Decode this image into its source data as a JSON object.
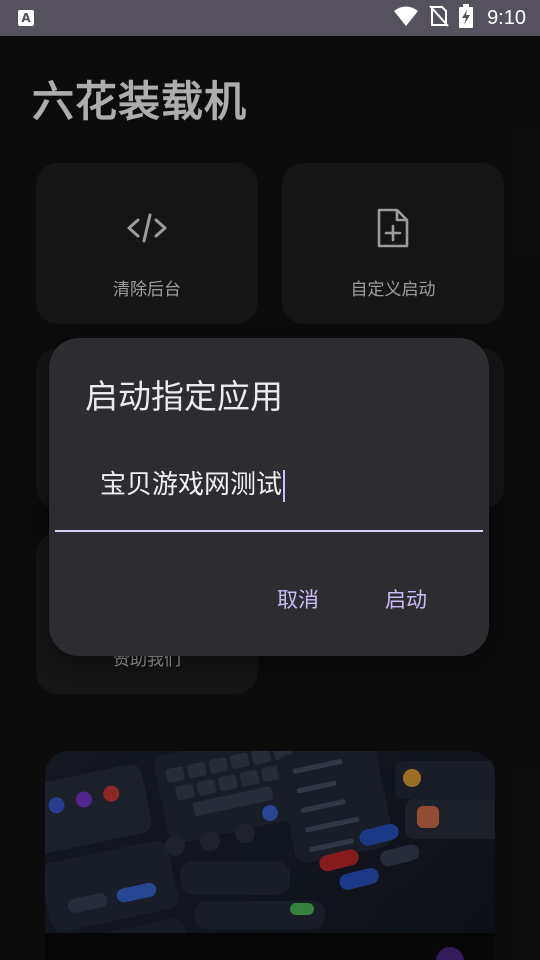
{
  "status_bar": {
    "app_icon": "A",
    "time": "9:10",
    "icons": [
      "wifi-icon",
      "no-sim-icon",
      "battery-charging-icon"
    ]
  },
  "page": {
    "title": "六花装载机"
  },
  "cards": {
    "clear_background": {
      "label": "清除后台",
      "icon": "code-icon"
    },
    "custom_launch": {
      "label": "自定义启动",
      "icon": "file-plus-icon"
    },
    "sponsor": {
      "label": "赞助我们"
    }
  },
  "dialog": {
    "title": "启动指定应用",
    "input_value": "宝贝游戏网测试",
    "cancel_label": "取消",
    "confirm_label": "启动"
  },
  "colors": {
    "status_bar": "#55525d",
    "background": "#131313",
    "card": "#1f1f1f",
    "dialog": "#2d2c31",
    "accent": "#cbbcf7"
  }
}
